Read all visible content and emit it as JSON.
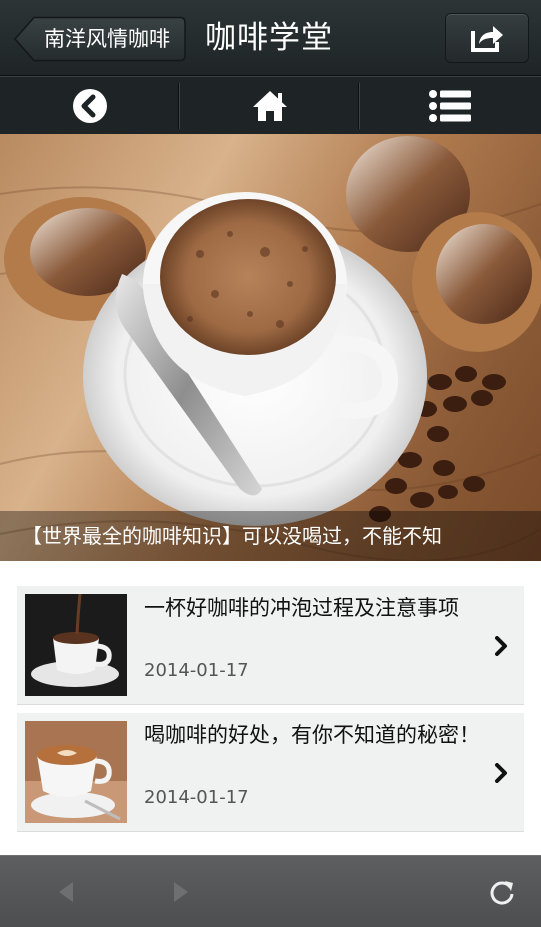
{
  "header": {
    "back_label": "南洋风情咖啡",
    "title": "咖啡学堂",
    "share_icon": "share-icon"
  },
  "nav": {
    "items": [
      {
        "icon": "back-circle-icon"
      },
      {
        "icon": "home-icon"
      },
      {
        "icon": "menu-list-icon"
      }
    ]
  },
  "banner": {
    "caption": "【世界最全的咖啡知识】可以没喝过，不能不知"
  },
  "articles": [
    {
      "title": "一杯好咖啡的冲泡过程及注意事项",
      "date": "2014-01-17"
    },
    {
      "title": "喝咖啡的好处，有你不知道的秘密！",
      "date": "2014-01-17"
    }
  ],
  "toolbar": {
    "back_icon": "browser-back-icon",
    "forward_icon": "browser-forward-icon",
    "refresh_icon": "refresh-icon"
  },
  "colors": {
    "header_bg": "#262d2f",
    "nav_bg": "#1e2426",
    "card_bg": "#f0f1f1",
    "toolbar_bg": "#565758"
  }
}
